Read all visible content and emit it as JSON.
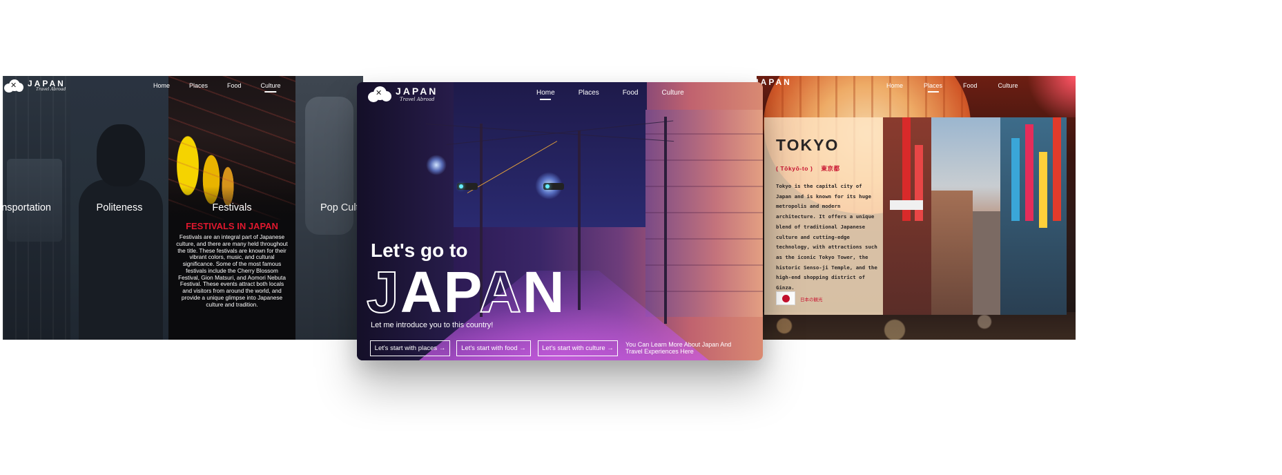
{
  "brand": {
    "title": "JAPAN",
    "subtitle": "Travel Abroad"
  },
  "left_panel": {
    "nav": [
      "Home",
      "Places",
      "Food",
      "Culture"
    ],
    "active_nav": "Culture",
    "strips": [
      "Transportation",
      "Politeness",
      "Festivals",
      "Pop Culture"
    ],
    "festival_heading": "FESTIVALS IN JAPAN",
    "festival_body": "Festivals are an integral part of Japanese culture, and there are many held throughout the title. These festivals are known for their vibrant colors, music, and cultural significance. Some of the most famous festivals include the Cherry Blossom Festival, Gion Matsuri, and Aomori Nebuta Festival. These events attract both locals and visitors from around the world, and provide a unique glimpse into Japanese culture and tradition."
  },
  "center_panel": {
    "nav": [
      "Home",
      "Places",
      "Food",
      "Culture"
    ],
    "active_nav": "Home",
    "hero_line1": "Let's go to",
    "hero_word": {
      "outline_1": "J",
      "solid_1": "AP",
      "outline_2": "A",
      "solid_2": "N"
    },
    "hero_intro": "Let me introduce you to this country!",
    "cta_places": "Let's start with places →",
    "cta_food": "Let's start with food →",
    "cta_culture": "Let's start with culture →",
    "learn_more": "You Can Learn More About Japan And Travel Experiences Here"
  },
  "right_panel": {
    "nav": [
      "Home",
      "Places",
      "Food",
      "Culture"
    ],
    "active_nav": "Places",
    "city_title": "TOKYO",
    "city_romaji": "( Tōkyō-to )",
    "city_kanji": "東京都",
    "city_body": "Tokyo is the capital city of Japan and is known for its huge metropolis and modern architecture. It offers a unique blend of traditional Japanese culture and cutting-edge technology, with attractions such as the iconic Tokyo Tower, the historic Senso-ji Temple, and the high-end shopping district of Ginza.",
    "flag_label": "日本の観光"
  },
  "colors": {
    "accent_red": "#c8102e",
    "festival_red": "#e0182e",
    "white": "#ffffff"
  },
  "icons": {
    "logo": "cloud-bird-logo-icon",
    "flag": "japan-flag-icon"
  }
}
